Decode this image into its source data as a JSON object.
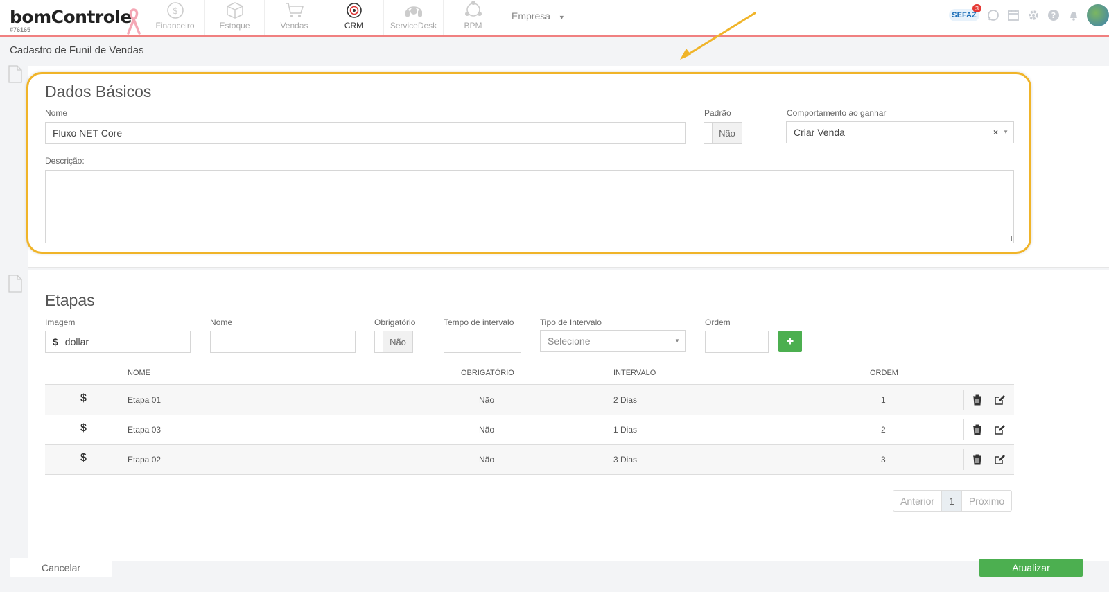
{
  "brand": {
    "logo": "bomControle",
    "account_id": "#76165"
  },
  "nav": [
    {
      "label": "Financeiro",
      "icon": "dollar-circle-icon"
    },
    {
      "label": "Estoque",
      "icon": "box-icon"
    },
    {
      "label": "Vendas",
      "icon": "cart-icon"
    },
    {
      "label": "CRM",
      "icon": "target-icon"
    },
    {
      "label": "ServiceDesk",
      "icon": "headset-icon"
    },
    {
      "label": "BPM",
      "icon": "workflow-icon"
    }
  ],
  "empresa": {
    "label": "Empresa"
  },
  "header_right": {
    "sefaz_label": "SEFAZ",
    "sefaz_badge": "3"
  },
  "page_title": "Cadastro de Funil de Vendas",
  "dados_basicos": {
    "title": "Dados Básicos",
    "nome_label": "Nome",
    "nome_value": "Fluxo NET Core",
    "padrao_label": "Padrão",
    "padrao_value": "Não",
    "comportamento_label": "Comportamento ao ganhar",
    "comportamento_value": "Criar Venda",
    "descricao_label": "Descrição:"
  },
  "etapas": {
    "title": "Etapas",
    "imagem_label": "Imagem",
    "imagem_value": "dollar",
    "imagem_symbol": "$",
    "nome_label": "Nome",
    "obrigatorio_label": "Obrigatório",
    "obrigatorio_value": "Não",
    "tempo_label": "Tempo de intervalo",
    "tipo_label": "Tipo de Intervalo",
    "tipo_placeholder": "Selecione",
    "ordem_label": "Ordem",
    "add_label": "+"
  },
  "table": {
    "columns": [
      "Nome",
      "Obrigatório",
      "Intervalo",
      "Ordem"
    ],
    "rows": [
      {
        "icon": "$",
        "nome": "Etapa 01",
        "obrigatorio": "Não",
        "intervalo": "2 Dias",
        "ordem": "1"
      },
      {
        "icon": "$",
        "nome": "Etapa 03",
        "obrigatorio": "Não",
        "intervalo": "1 Dias",
        "ordem": "2"
      },
      {
        "icon": "$",
        "nome": "Etapa 02",
        "obrigatorio": "Não",
        "intervalo": "3 Dias",
        "ordem": "3"
      }
    ]
  },
  "pagination": {
    "prev": "Anterior",
    "current": "1",
    "next": "Próximo"
  },
  "footer": {
    "cancel": "Cancelar",
    "save": "Atualizar"
  },
  "colors": {
    "accent_green": "#4caf50",
    "highlight": "#f0b429",
    "topbar_border": "#f08080"
  }
}
